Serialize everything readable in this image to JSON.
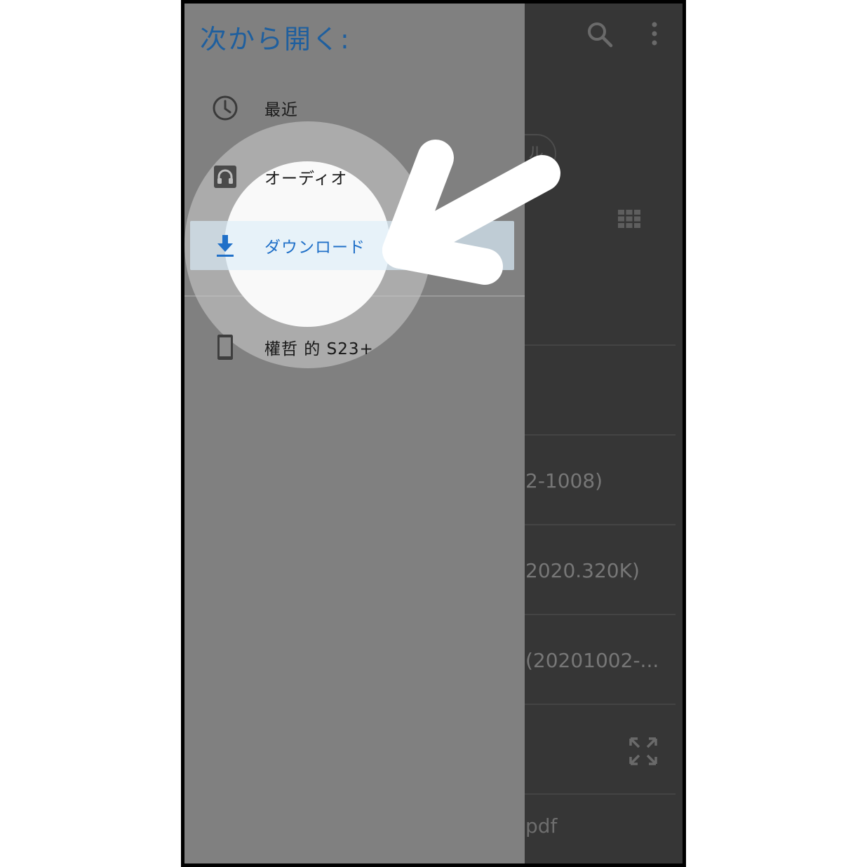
{
  "drawer": {
    "title": "次から開く:",
    "items": [
      {
        "label": "最近",
        "icon": "clock-icon"
      },
      {
        "label": "オーディオ",
        "icon": "headphones-icon"
      },
      {
        "label": "ダウンロード",
        "icon": "download-icon",
        "selected": true
      },
      {
        "label": "權哲 的 S23+",
        "icon": "phone-icon"
      }
    ]
  },
  "background": {
    "chip_label": "ル",
    "files": [
      "",
      "2-1008)",
      "2020.320K)",
      "(20201002-...",
      ""
    ],
    "bottom_text": "pdf"
  },
  "colors": {
    "accent_blue": "#2070c8",
    "title_blue": "#1f5f9e",
    "drawer_bg": "#808080",
    "dim_bg": "#363636"
  }
}
